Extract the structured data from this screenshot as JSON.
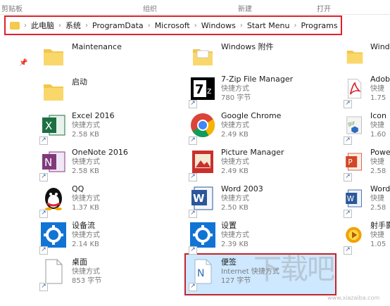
{
  "ribbon": {
    "groups": [
      "剪贴板",
      "组织",
      "新建",
      "打开"
    ]
  },
  "address": {
    "crumbs": [
      "此电脑",
      "系统",
      "ProgramData",
      "Microsoft",
      "Windows",
      "Start Menu",
      "Programs"
    ]
  },
  "col1": [
    {
      "name": "Maintenance",
      "type": "",
      "size": ""
    },
    {
      "name": "启动",
      "type": "",
      "size": ""
    },
    {
      "name": "Excel 2016",
      "type": "快捷方式",
      "size": "2.58 KB"
    },
    {
      "name": "OneNote 2016",
      "type": "快捷方式",
      "size": "2.58 KB"
    },
    {
      "name": "QQ",
      "type": "快捷方式",
      "size": "1.37 KB"
    },
    {
      "name": "设备流",
      "type": "快捷方式",
      "size": "2.14 KB"
    },
    {
      "name": "桌面",
      "type": "快捷方式",
      "size": "853 字节"
    }
  ],
  "col2": [
    {
      "name": "Windows 附件",
      "type": "",
      "size": ""
    },
    {
      "name": "7-Zip File Manager",
      "type": "快捷方式",
      "size": "780 字节"
    },
    {
      "name": "Google Chrome",
      "type": "快捷方式",
      "size": "2.49 KB"
    },
    {
      "name": "Picture Manager",
      "type": "快捷方式",
      "size": "2.49 KB"
    },
    {
      "name": "Word 2003",
      "type": "快捷方式",
      "size": "2.50 KB"
    },
    {
      "name": "设置",
      "type": "快捷方式",
      "size": "2.39 KB"
    },
    {
      "name": "便签",
      "type": "Internet 快捷方式",
      "size": "127 字节"
    }
  ],
  "col3": [
    {
      "name": "Wind",
      "type": "",
      "size": ""
    },
    {
      "name": "Adob",
      "type": "快捷",
      "size": "1.75"
    },
    {
      "name": "Icon",
      "type": "快捷",
      "size": "1.60"
    },
    {
      "name": "Powe",
      "type": "快捷",
      "size": "2.58"
    },
    {
      "name": "Word",
      "type": "快捷",
      "size": "2.58"
    },
    {
      "name": "射手影",
      "type": "快捷",
      "size": "1.05"
    }
  ],
  "watermark": {
    "main": "下载吧",
    "sub": "www.xiazaiba.com"
  }
}
